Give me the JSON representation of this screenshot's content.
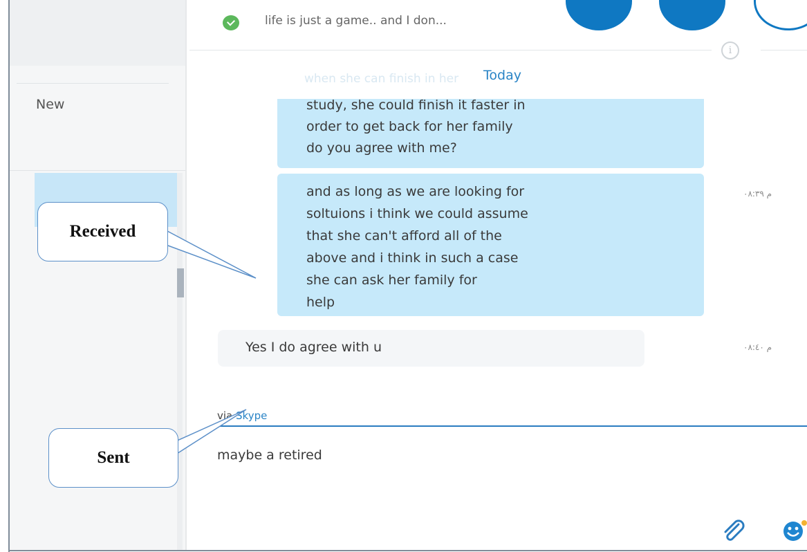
{
  "header": {
    "mood_message": "life is just a game.. and I don...",
    "status": "online"
  },
  "sidebar": {
    "new_label": "New"
  },
  "conversation": {
    "date_divider": "Today",
    "ghost_text": "when she can finish in her",
    "messages": [
      {
        "direction": "received",
        "lines": [
          "study, she could finish it faster in",
          "order to get back for her family",
          "do you agree with me?"
        ],
        "timestamp": ""
      },
      {
        "direction": "received",
        "lines": [
          "and as long as we are looking for",
          "soltuions i think we could assume",
          "that she can't afford all of the",
          "above and i think in such a case",
          "she can ask her family for",
          "help"
        ],
        "timestamp": "م ٠٨:٣٩"
      },
      {
        "direction": "sent",
        "lines": [
          "Yes I do agree with u"
        ],
        "timestamp": "م ٠٨:٤٠"
      }
    ]
  },
  "composer": {
    "via_prefix": "via",
    "via_service": "Skype",
    "text": "maybe a retired"
  },
  "annotations": {
    "received_label": "Received",
    "sent_label": "Sent"
  },
  "icons": {
    "status": "checkmark-icon",
    "info": "info-icon",
    "attach": "paperclip-icon",
    "emoji": "emoticon-icon"
  },
  "colors": {
    "accent": "#0f78c2",
    "received_bubble": "#c6e9fa",
    "sent_bubble": "#f4f6f8",
    "link": "#2a84c6"
  }
}
